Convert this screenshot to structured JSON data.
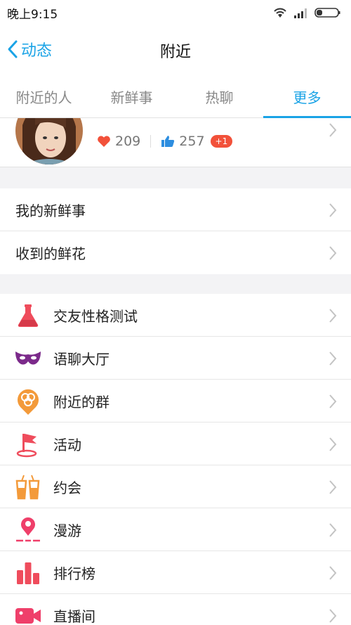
{
  "status": {
    "time": "晚上9:15"
  },
  "nav": {
    "back_label": "动态",
    "title": "附近"
  },
  "tabs": [
    {
      "label": "附近的人",
      "active": false
    },
    {
      "label": "新鲜事",
      "active": false
    },
    {
      "label": "热聊",
      "active": false
    },
    {
      "label": "更多",
      "active": true
    }
  ],
  "profile": {
    "hearts": "209",
    "likes": "257",
    "likes_badge": "+1"
  },
  "group1": [
    {
      "label": "我的新鲜事"
    },
    {
      "label": "收到的鲜花"
    }
  ],
  "group2": [
    {
      "label": "交友性格测试",
      "icon": "flask-icon",
      "color": "#ef4c5c"
    },
    {
      "label": "语聊大厅",
      "icon": "mask-icon",
      "color": "#7b2a8a"
    },
    {
      "label": "附近的群",
      "icon": "group-pin-icon",
      "color": "#f39a3a"
    },
    {
      "label": "活动",
      "icon": "flag-icon",
      "color": "#ef4c5c"
    },
    {
      "label": "约会",
      "icon": "drinks-icon",
      "color": "#f39a3a"
    },
    {
      "label": "漫游",
      "icon": "location-pin-icon",
      "color": "#ef3f6a"
    },
    {
      "label": "排行榜",
      "icon": "bar-chart-icon",
      "color": "#ef4c5c"
    },
    {
      "label": "直播间",
      "icon": "video-camera-icon",
      "color": "#ef3f6a"
    }
  ],
  "colors": {
    "accent": "#1aa3e6",
    "badge": "#f2513a"
  }
}
